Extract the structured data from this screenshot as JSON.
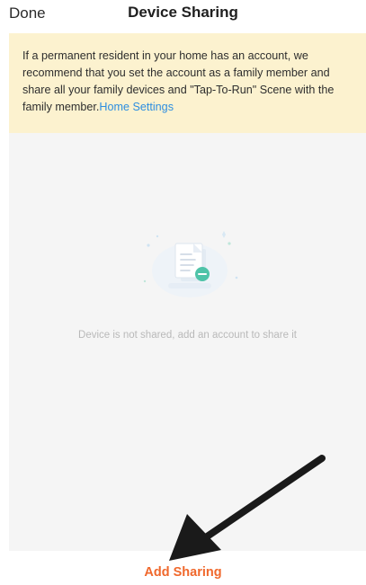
{
  "header": {
    "done_label": "Done",
    "title": "Device Sharing"
  },
  "notice": {
    "text": "If a permanent resident in your home has an account, we recommend that you set the account as a family member and share all your family devices and \"Tap-To-Run\" Scene with the family member.",
    "link_label": "Home Settings"
  },
  "empty_state": {
    "icon": "document-remove-icon",
    "message": "Device is not shared, add an account to share it"
  },
  "footer": {
    "add_sharing_label": "Add Sharing"
  },
  "colors": {
    "accent": "#f0682c",
    "link": "#2d8ee0",
    "notice_background": "#fcf2cf",
    "content_background": "#f5f5f5",
    "icon_teal": "#4fc3a8"
  }
}
